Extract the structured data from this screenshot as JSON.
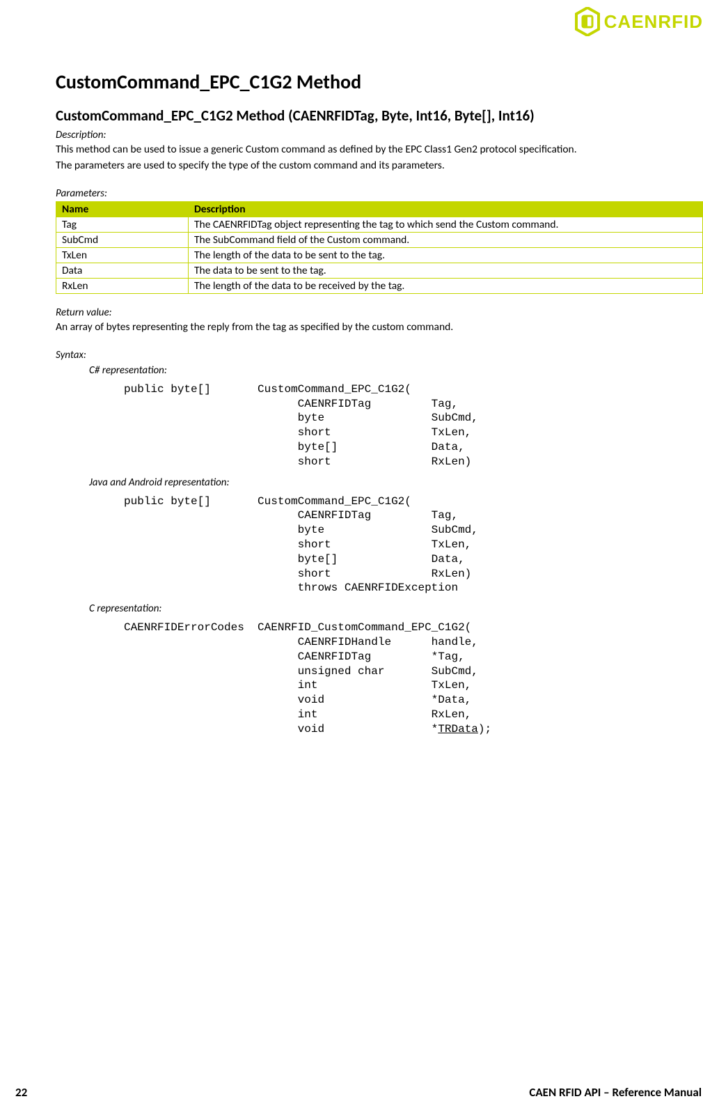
{
  "brand": "CAENRFID",
  "heading": "CustomCommand_EPC_C1G2 Method",
  "subheading": "CustomCommand_EPC_C1G2 Method (CAENRFIDTag, Byte, Int16, Byte[], Int16)",
  "description_label": "Description:",
  "description_line1": "This method can be used to issue a generic Custom command as defined by the EPC Class1 Gen2 protocol specification.",
  "description_line2": "The parameters are used to specify the type of the custom command and its parameters.",
  "parameters_label": "Parameters:",
  "params_table": {
    "headers": {
      "name": "Name",
      "description": "Description"
    },
    "rows": [
      {
        "name": "Tag",
        "description": "The CAENRFIDTag object representing the tag to which send the Custom command."
      },
      {
        "name": "SubCmd",
        "description": "The SubCommand field of the Custom command."
      },
      {
        "name": "TxLen",
        "description": "The length of the data to be sent to the tag."
      },
      {
        "name": "Data",
        "description": "The data to be sent to the tag."
      },
      {
        "name": "RxLen",
        "description": "The length of the data to be received by the tag."
      }
    ]
  },
  "return_label": "Return value:",
  "return_text": "An array of bytes representing the reply from the tag as specified by the custom command.",
  "syntax_label": "Syntax:",
  "repr": {
    "csharp_label": "C# representation:",
    "csharp_code": "public byte[]       CustomCommand_EPC_C1G2(\n                          CAENRFIDTag         Tag,\n                          byte                SubCmd,\n                          short               TxLen,\n                          byte[]              Data,\n                          short               RxLen)",
    "java_label": "Java and Android representation:",
    "java_code": "public byte[]       CustomCommand_EPC_C1G2(\n                          CAENRFIDTag         Tag,\n                          byte                SubCmd,\n                          short               TxLen,\n                          byte[]              Data,\n                          short               RxLen)\n                          throws CAENRFIDException",
    "c_label": "C representation:",
    "c_code_pre": "CAENRFIDErrorCodes  CAENRFID_CustomCommand_EPC_C1G2(\n                          CAENRFIDHandle      handle,\n                          CAENRFIDTag         *Tag,\n                          unsigned char       SubCmd,\n                          int                 TxLen,\n                          void                *Data,\n                          int                 RxLen,\n                          void                *",
    "c_code_link": "TRData",
    "c_code_post": ");"
  },
  "footer": {
    "page": "22",
    "text": "CAEN RFID API – Reference Manual"
  }
}
